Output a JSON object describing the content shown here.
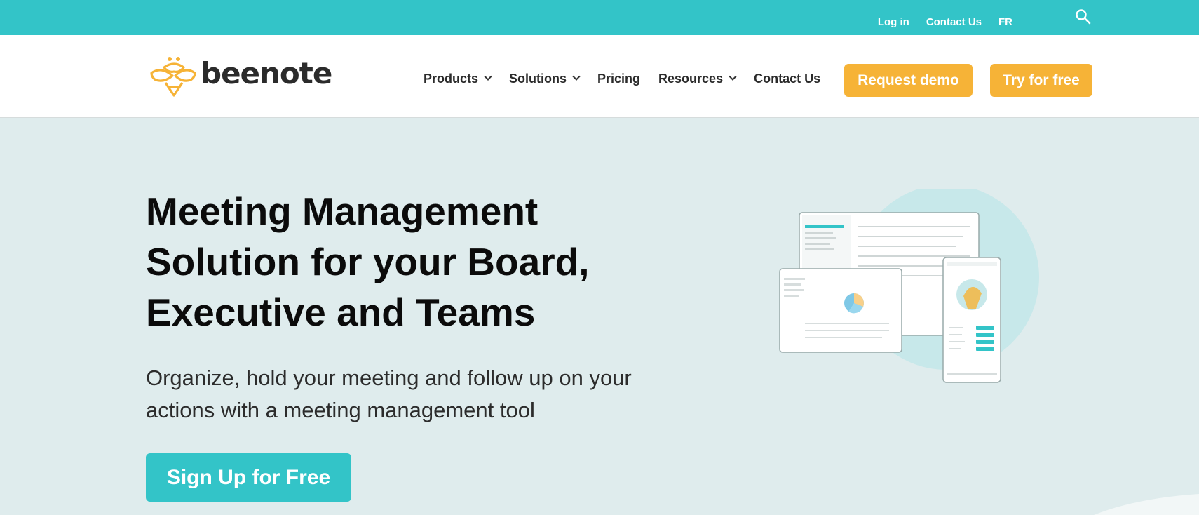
{
  "topbar": {
    "links": [
      "Log in",
      "Contact Us",
      "FR"
    ],
    "search_icon": "search-icon",
    "bg_color": "#33c4c8"
  },
  "navbar": {
    "logo_text": "beenote",
    "menu": [
      {
        "label": "Products",
        "dropdown": true
      },
      {
        "label": "Solutions",
        "dropdown": true
      },
      {
        "label": "Pricing",
        "dropdown": false
      },
      {
        "label": "Resources",
        "dropdown": true
      },
      {
        "label": "Contact Us",
        "dropdown": false
      }
    ],
    "request_demo": "Request demo",
    "try_free": "Try for free",
    "accent_color": "#f6b337"
  },
  "hero": {
    "title_lines": [
      "Meeting Management",
      "Solution for your Board,",
      "Executive and Teams"
    ],
    "subtitle_lines": [
      "Organize, hold your meeting and follow up on your",
      "actions with a meeting management tool"
    ],
    "cta": "Sign Up for Free",
    "cta_color": "#33c4c8"
  }
}
